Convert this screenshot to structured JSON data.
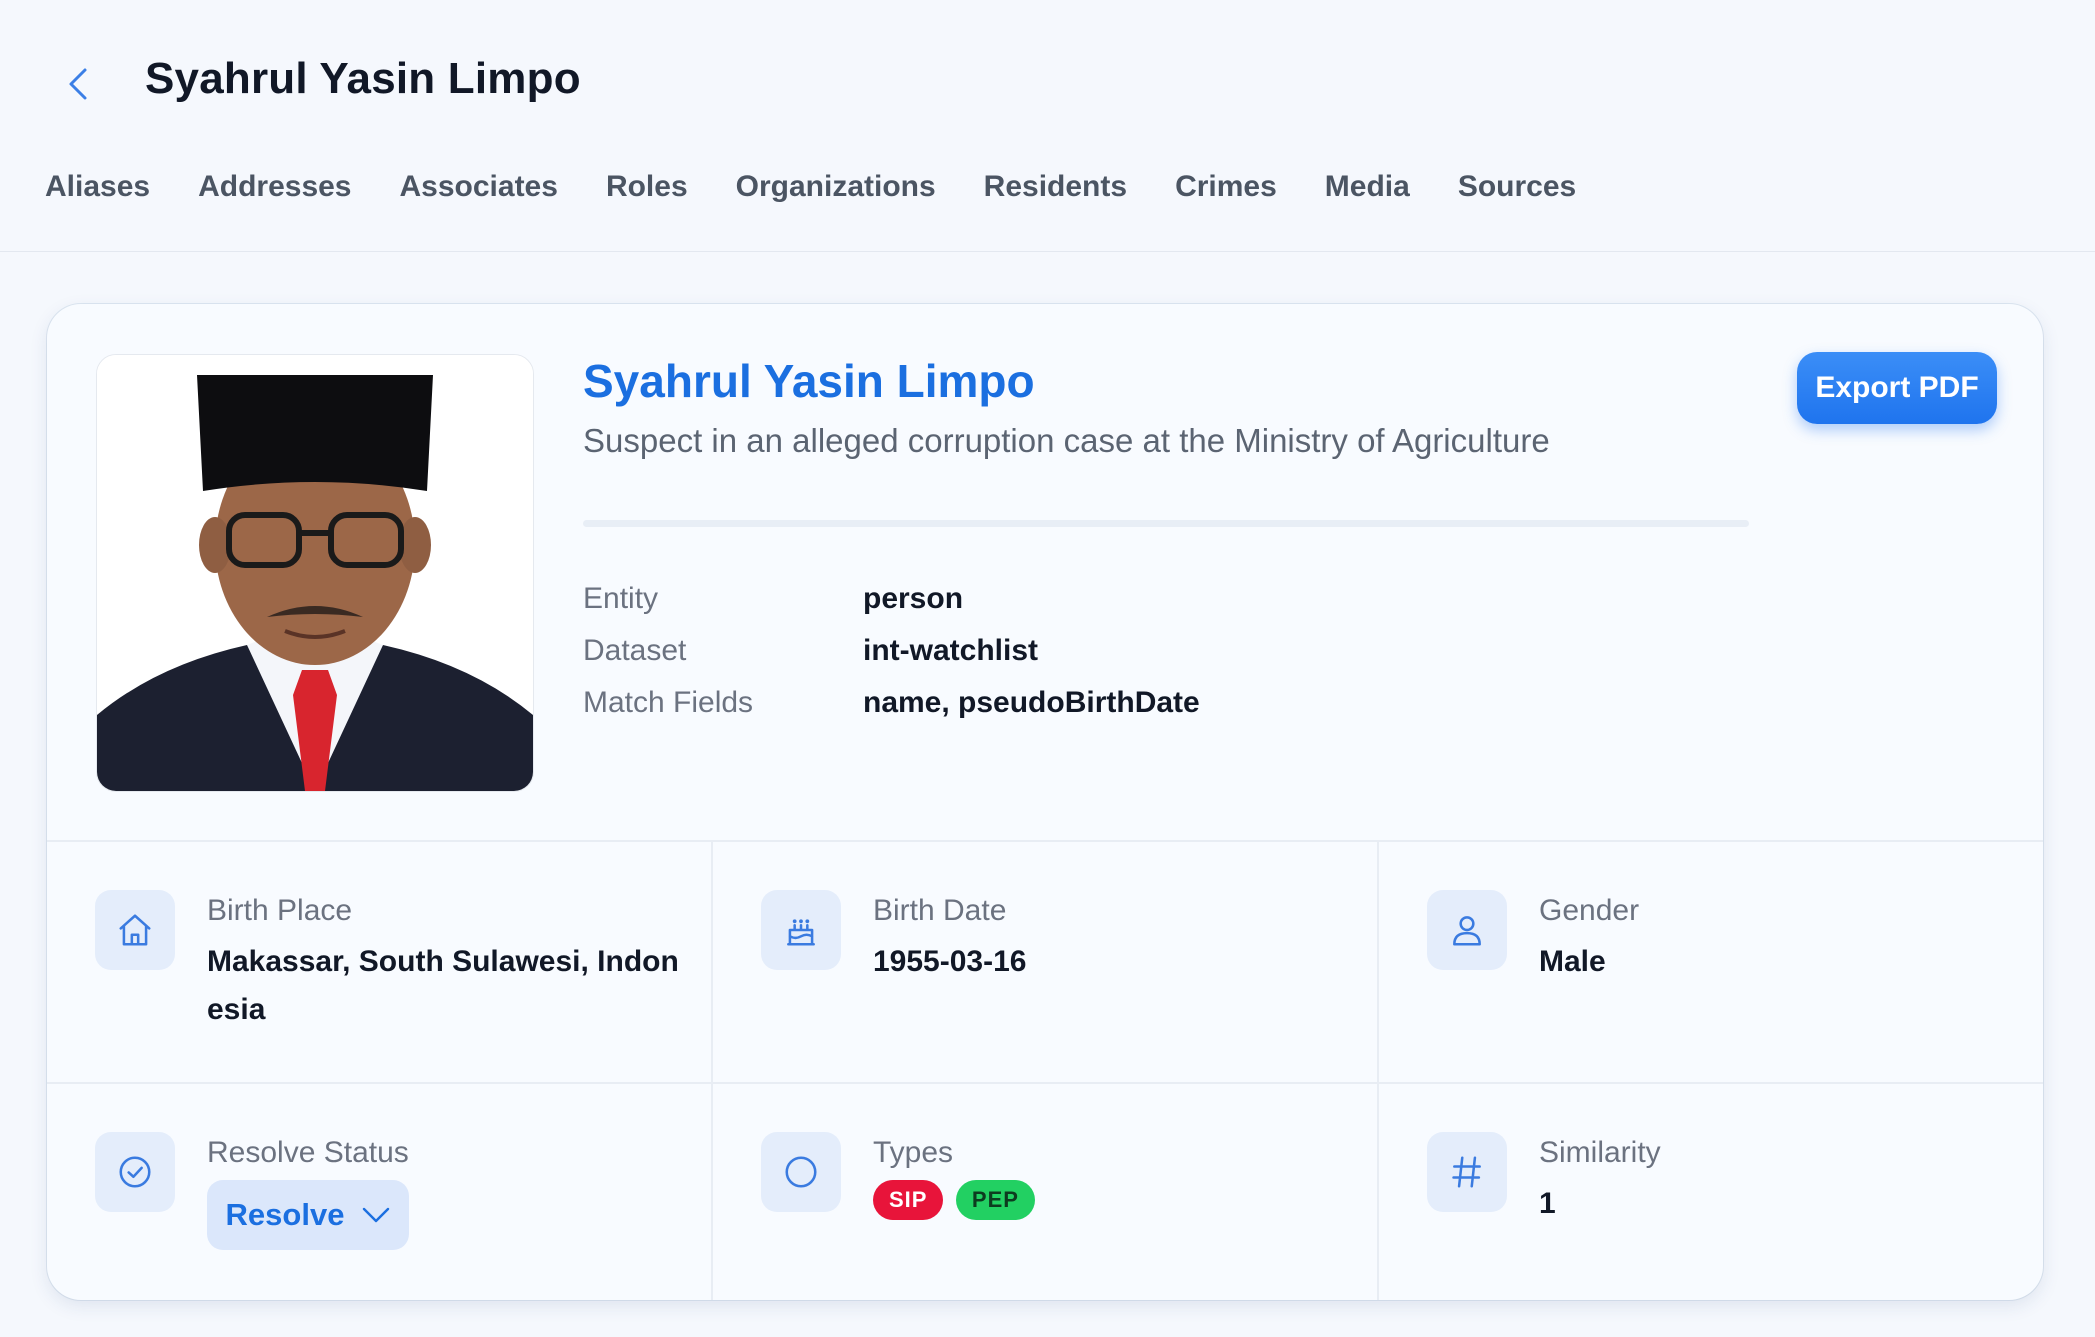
{
  "header": {
    "title": "Syahrul Yasin Limpo",
    "tabs": [
      {
        "label": "Aliases"
      },
      {
        "label": "Addresses"
      },
      {
        "label": "Associates"
      },
      {
        "label": "Roles"
      },
      {
        "label": "Organizations"
      },
      {
        "label": "Residents"
      },
      {
        "label": "Crimes"
      },
      {
        "label": "Media"
      },
      {
        "label": "Sources"
      }
    ]
  },
  "profile": {
    "name": "Syahrul Yasin Limpo",
    "description": "Suspect in an alleged corruption case at the Ministry of Agriculture",
    "export_label": "Export PDF",
    "meta": [
      {
        "label": "Entity",
        "value": "person"
      },
      {
        "label": "Dataset",
        "value": "int-watchlist"
      },
      {
        "label": "Match Fields",
        "value": "name, pseudoBirthDate"
      }
    ]
  },
  "details": {
    "birth_place": {
      "label": "Birth Place",
      "value_line1": "Makassar, South Sulawesi, Indon",
      "value_line2": "esia",
      "icon": "home-icon"
    },
    "birth_date": {
      "label": "Birth Date",
      "value": "1955-03-16",
      "icon": "cake-icon"
    },
    "gender": {
      "label": "Gender",
      "value": "Male",
      "icon": "user-icon"
    },
    "resolve_status": {
      "label": "Resolve Status",
      "value": "Resolve",
      "icon": "check-circle-icon"
    },
    "types": {
      "label": "Types",
      "badges": [
        "SIP",
        "PEP"
      ],
      "icon": "circle-icon"
    },
    "similarity": {
      "label": "Similarity",
      "value": "1",
      "icon": "hash-icon"
    }
  },
  "colors": {
    "accent": "#1b6fe0",
    "badge_sip": "#e8143a",
    "badge_pep": "#22d062"
  }
}
